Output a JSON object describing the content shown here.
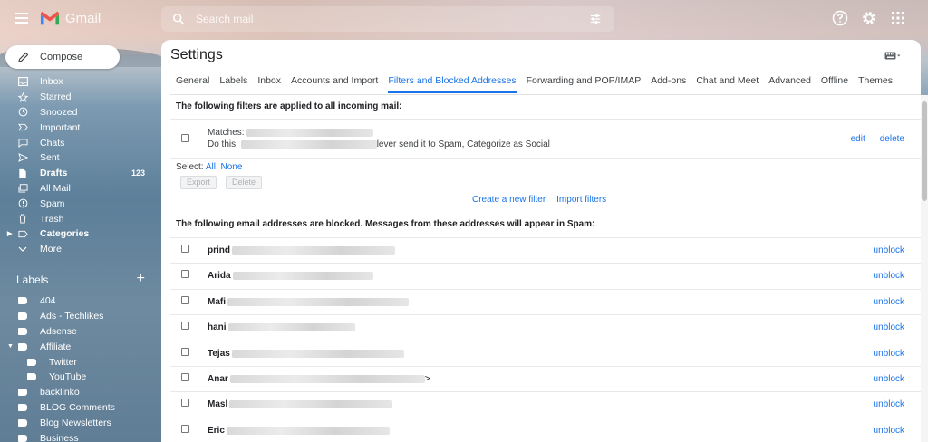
{
  "app": {
    "logo_text": "Gmail",
    "search_placeholder": "Search mail"
  },
  "compose_label": "Compose",
  "nav": [
    {
      "label": "Inbox",
      "icon": "inbox-icon"
    },
    {
      "label": "Starred",
      "icon": "star-icon"
    },
    {
      "label": "Snoozed",
      "icon": "clock-icon"
    },
    {
      "label": "Important",
      "icon": "important-icon"
    },
    {
      "label": "Chats",
      "icon": "chat-icon"
    },
    {
      "label": "Sent",
      "icon": "send-icon"
    },
    {
      "label": "Drafts",
      "icon": "draft-icon",
      "count": "123",
      "bold": true
    },
    {
      "label": "All Mail",
      "icon": "all-mail-icon"
    },
    {
      "label": "Spam",
      "icon": "spam-icon"
    },
    {
      "label": "Trash",
      "icon": "trash-icon"
    },
    {
      "label": "Categories",
      "icon": "categories-icon",
      "bold": true
    },
    {
      "label": "More",
      "icon": "chevron-down-icon"
    }
  ],
  "labels_heading": "Labels",
  "labels": [
    {
      "label": "404"
    },
    {
      "label": "Ads - Techlikes"
    },
    {
      "label": "Adsense"
    },
    {
      "label": "Affiliate"
    },
    {
      "label": "Twitter"
    },
    {
      "label": "YouTube"
    },
    {
      "label": "backlinko"
    },
    {
      "label": "BLOG Comments"
    },
    {
      "label": "Blog Newsletters"
    },
    {
      "label": "Business"
    }
  ],
  "settings": {
    "title": "Settings",
    "tabs": [
      "General",
      "Labels",
      "Inbox",
      "Accounts and Import",
      "Filters and Blocked Addresses",
      "Forwarding and POP/IMAP",
      "Add-ons",
      "Chat and Meet",
      "Advanced",
      "Offline",
      "Themes"
    ],
    "active_tab": "Filters and Blocked Addresses",
    "filters_heading": "The following filters are applied to all incoming mail:",
    "filter": {
      "matches_label": "Matches:",
      "do_this_label": "Do this:",
      "action_suffix": "lever send it to Spam, Categorize as Social",
      "edit": "edit",
      "delete": "delete"
    },
    "select_label": "Select:",
    "select_all": "All",
    "select_sep": ",",
    "select_none": "None",
    "export_button": "Export",
    "delete_button": "Delete",
    "create_filter": "Create a new filter",
    "import_filters": "Import filters",
    "blocked_heading": "The following email addresses are blocked. Messages from these addresses will appear in Spam:",
    "blocked": [
      {
        "prefix": "prind"
      },
      {
        "prefix": "Arida"
      },
      {
        "prefix": "Mafi"
      },
      {
        "prefix": "hani"
      },
      {
        "prefix": "Tejas"
      },
      {
        "prefix": "Anar",
        "suffix": ">"
      },
      {
        "prefix": "Masl"
      },
      {
        "prefix": "Eric"
      }
    ],
    "unblock_label": "unblock"
  }
}
